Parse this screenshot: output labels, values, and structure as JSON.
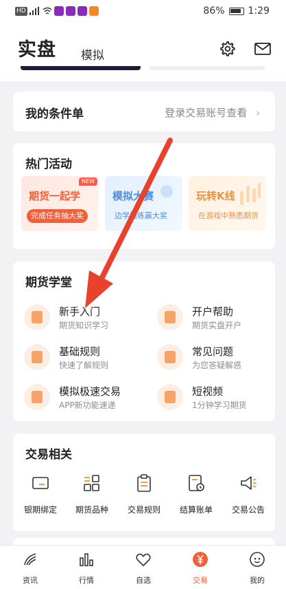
{
  "status_bar": {
    "carrier": "HD",
    "battery": "86%",
    "time": "1:29"
  },
  "header": {
    "title": "实盘",
    "subtitle": "模拟",
    "icons": [
      "gear-icon",
      "mail-icon"
    ]
  },
  "conditions": {
    "title": "我的条件单",
    "action": "登录交易账号查看"
  },
  "activities": {
    "title": "热门活动",
    "items": [
      {
        "title": "期货一起学",
        "sub": "完成任务抽大奖",
        "badge": "NEW",
        "color": "#f0603a"
      },
      {
        "title": "模拟大赛",
        "sub": "边学边练赢大奖",
        "color": "#4a8fe0"
      },
      {
        "title": "玩转K线",
        "sub": "在游戏中熟悉期货",
        "color": "#f0903a"
      }
    ]
  },
  "learn": {
    "title": "期货学堂",
    "items": [
      {
        "name": "新手入门",
        "desc": "期货知识学习",
        "icon": "signpost-icon"
      },
      {
        "name": "开户帮助",
        "desc": "期货实盘开户",
        "icon": "form-icon"
      },
      {
        "name": "基础规则",
        "desc": "快速了解规则",
        "icon": "document-icon"
      },
      {
        "name": "常见问题",
        "desc": "为您答疑解惑",
        "icon": "question-icon"
      },
      {
        "name": "模拟极速交易",
        "desc": "APP新功能速递",
        "icon": "grid-search-icon"
      },
      {
        "name": "短视频",
        "desc": "1分钟学习期货",
        "icon": "video-icon"
      }
    ]
  },
  "trade": {
    "title": "交易相关",
    "items": [
      {
        "label": "银期绑定",
        "icon": "card-icon"
      },
      {
        "label": "期货品种",
        "icon": "grid-icon"
      },
      {
        "label": "交易规则",
        "icon": "clipboard-icon"
      },
      {
        "label": "结算账单",
        "icon": "bill-icon"
      },
      {
        "label": "交易公告",
        "icon": "megaphone-icon"
      }
    ]
  },
  "bottom_nav": {
    "items": [
      {
        "label": "资讯",
        "icon": "news-icon"
      },
      {
        "label": "行情",
        "icon": "bars-icon"
      },
      {
        "label": "自选",
        "icon": "heart-icon"
      },
      {
        "label": "交易",
        "icon": "yuan-icon",
        "active": true
      },
      {
        "label": "我的",
        "icon": "profile-icon"
      }
    ]
  },
  "colors": {
    "accent": "#f0603a",
    "arrow": "#e8412c"
  }
}
